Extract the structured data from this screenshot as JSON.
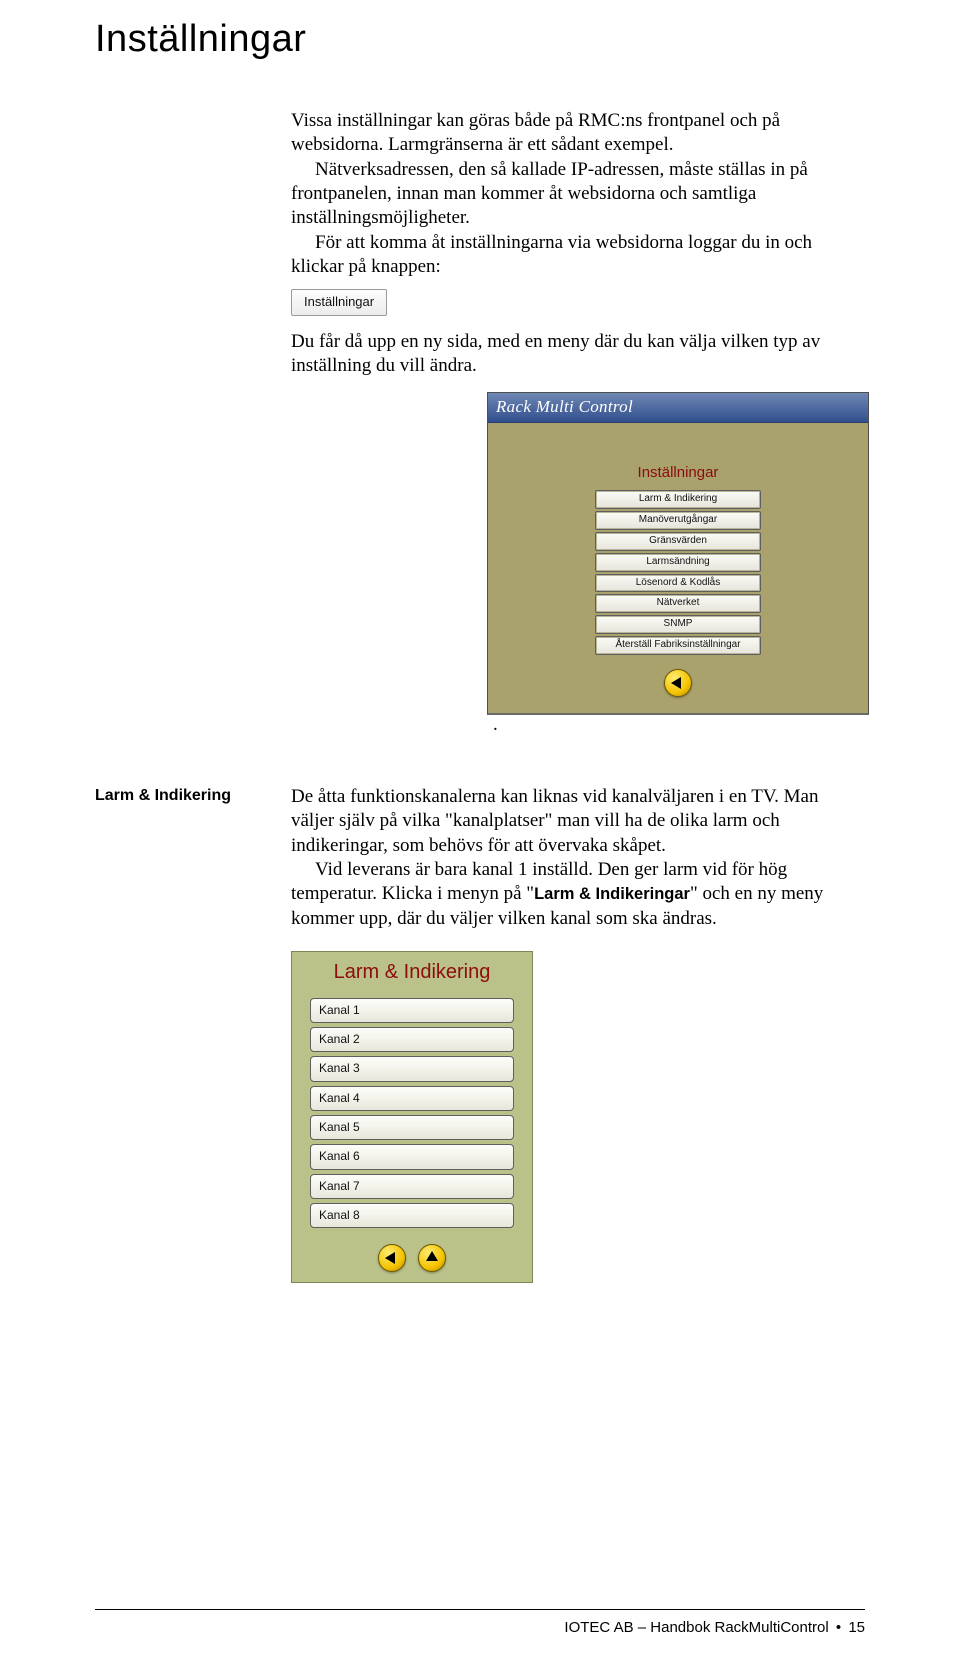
{
  "page_title": "Inställningar",
  "intro": {
    "p1": "Vissa inställningar kan göras både på RMC:ns frontpanel och på websidorna. Larmgränserna är ett sådant exempel.",
    "p2": "Nätverksadressen, den så kallade IP-adressen, måste ställas in på frontpanelen, innan man kommer åt websidorna och samtliga inställningsmöjligheter.",
    "p3": "För att komma åt inställningarna via websidorna loggar du in och klickar på knappen:",
    "btn_label": "Inställningar",
    "p4": "Du får då upp en ny sida, med en meny där du kan välja vilken typ av inställning du vill ändra."
  },
  "rmc_panel": {
    "title": "Rack Multi Control",
    "heading": "Inställningar",
    "items": [
      "Larm & Indikering",
      "Manöverutgångar",
      "Gränsvärden",
      "Larmsändning",
      "Lösenord & Kodlås",
      "Nätverket",
      "SNMP",
      "Återställ Fabriksinställningar"
    ]
  },
  "trailing_dot": ".",
  "larm_section": {
    "side_label": "Larm & Indikering",
    "p1": "De åtta funktionskanalerna kan liknas vid kanalväljaren i en TV. Man väljer själv på vilka \"kanalplatser\" man vill ha de olika larm och indikeringar, som behövs för att övervaka skåpet.",
    "p2a": "Vid leverans är bara kanal 1 inställd. Den ger larm vid för hög temperatur. Klicka i menyn på \"",
    "p2_bold": "Larm & Indikeringar",
    "p2b": "\" och en ny meny kommer upp, där du väljer vilken kanal som ska ändras."
  },
  "larm_panel": {
    "title": "Larm & Indikering",
    "items": [
      "Kanal 1",
      "Kanal 2",
      "Kanal 3",
      "Kanal 4",
      "Kanal 5",
      "Kanal 6",
      "Kanal 7",
      "Kanal 8"
    ]
  },
  "footer": {
    "left": "IOTEC AB – Handbok RackMultiControl",
    "bullet": "•",
    "page": "15"
  }
}
